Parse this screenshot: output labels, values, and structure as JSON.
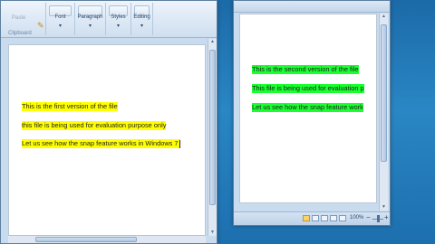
{
  "left_window": {
    "ribbon": {
      "paste_label": "Paste",
      "clipboard_label": "Clipboard",
      "groups": [
        {
          "label": "Font"
        },
        {
          "label": "Paragraph"
        },
        {
          "label": "Styles"
        },
        {
          "label": "Editing"
        }
      ]
    },
    "document_lines": [
      "This is the first version of the file",
      "this file is being used for evaluation purpose only",
      "Let us see how the snap feature works in Windows 7"
    ]
  },
  "right_window": {
    "document_lines": [
      "This is the second version of the file",
      "This file is being used for evaluation p",
      "Let us see how the snap feature work"
    ],
    "status": {
      "zoom": "100%"
    }
  },
  "colors": {
    "highlight_left": "#ffff00",
    "highlight_right": "#19ff30",
    "desktop": "#2a86c4"
  }
}
